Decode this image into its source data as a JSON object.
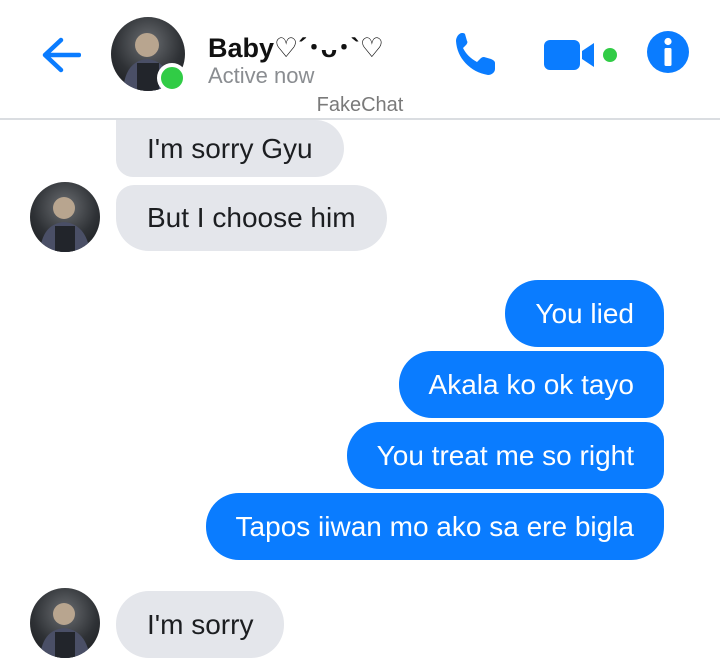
{
  "header": {
    "contact_name": "Baby♡´･ᴗ･`♡",
    "status": "Active now",
    "watermark": "FakeChat",
    "icons": {
      "back": "arrow-left-icon",
      "call": "phone-icon",
      "video": "video-camera-icon",
      "info": "info-icon",
      "online": "online-dot"
    },
    "accent_color": "#0a7cff",
    "online_color": "#31cc46"
  },
  "messages": [
    {
      "sender": "contact",
      "text": "I'm sorry Gyu"
    },
    {
      "sender": "contact",
      "text": "But I choose him"
    },
    {
      "sender": "me",
      "text": "You lied"
    },
    {
      "sender": "me",
      "text": "Akala ko ok tayo"
    },
    {
      "sender": "me",
      "text": "You treat me so right"
    },
    {
      "sender": "me",
      "text": "Tapos iiwan mo ako sa ere bigla"
    },
    {
      "sender": "contact",
      "text": "I'm sorry"
    }
  ],
  "colors": {
    "incoming_bubble": "#e4e6eb",
    "outgoing_bubble": "#0a7cff"
  }
}
